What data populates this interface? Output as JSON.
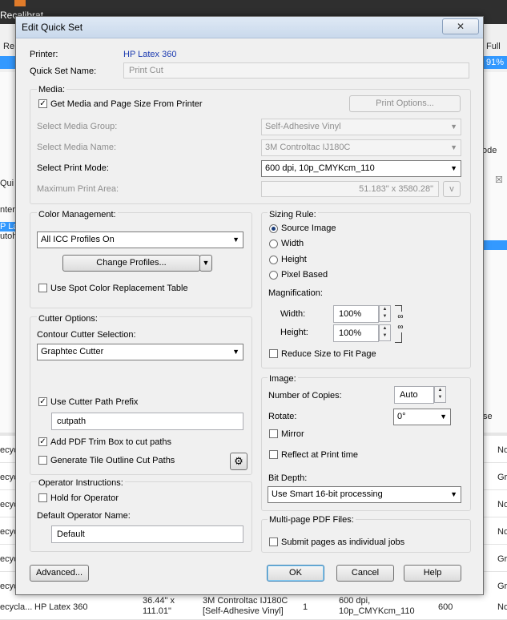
{
  "background": {
    "app_title": "Recalibrat",
    "header_re": "Re",
    "header_full": "Full",
    "percent": "91%",
    "mode_label": "ode",
    "side_qui": "Qui",
    "side_nter": "nter",
    "side_plat": "P Lat",
    "side_utoh": "utoh",
    "se_label": "se",
    "rows": [
      {
        "left": "ecyc",
        "right": "No"
      },
      {
        "left": "ecyc",
        "right": "Gr"
      },
      {
        "left": "ecyc",
        "right": "No"
      },
      {
        "left": "ecyc",
        "right": "No"
      },
      {
        "left": "ecyc",
        "right": "Gr"
      },
      {
        "left": "ecyc",
        "right": "Gr"
      }
    ],
    "bottom_row": {
      "c1": "ecycla...",
      "c2": "HP Latex 360",
      "c3a": "36.44\" x",
      "c3b": "111.01\"",
      "c4a": "3M Controltac IJ180C",
      "c4b": "[Self-Adhesive Vinyl]",
      "c5": "1",
      "c6a": "600 dpi,",
      "c6b": "10p_CMYKcm_110",
      "c7": "600",
      "c8": "No"
    }
  },
  "dialog": {
    "title": "Edit Quick Set",
    "close_label": "✕",
    "printer_label": "Printer:",
    "printer_value": "HP Latex 360",
    "quickset_label": "Quick Set Name:",
    "quickset_value": "Print Cut",
    "media": {
      "group_label": "Media:",
      "get_media_label": "Get Media and Page Size From Printer",
      "print_options_label": "Print Options...",
      "media_group_label": "Select Media Group:",
      "media_group_value": "Self-Adhesive Vinyl",
      "media_name_label": "Select Media Name:",
      "media_name_value": "3M Controltac IJ180C",
      "print_mode_label": "Select Print Mode:",
      "print_mode_value": "600 dpi, 10p_CMYKcm_110",
      "max_area_label": "Maximum Print Area:",
      "max_area_value": "51.183\" x 3580.28\"",
      "max_area_unit": "v"
    },
    "color": {
      "group_label": "Color Management:",
      "icc_value": "All ICC Profiles On",
      "change_profiles_label": "Change Profiles...",
      "spot_label": "Use Spot Color Replacement Table"
    },
    "cutter": {
      "group_label": "Cutter Options:",
      "contour_label": "Contour Cutter Selection:",
      "cutter_value": "Graphtec Cutter",
      "prefix_label": "Use Cutter Path Prefix",
      "prefix_value": "cutpath",
      "trimbox_label": "Add PDF Trim Box to cut paths",
      "tile_label": "Generate Tile Outline Cut Paths"
    },
    "operator": {
      "group_label": "Operator Instructions:",
      "hold_label": "Hold for Operator",
      "default_name_label": "Default Operator Name:",
      "default_name_value": "Default"
    },
    "sizing": {
      "group_label": "Sizing Rule:",
      "options": [
        "Source Image",
        "Width",
        "Height",
        "Pixel Based"
      ],
      "magnification_label": "Magnification:",
      "width_label": "Width:",
      "width_value": "100%",
      "height_label": "Height:",
      "height_value": "100%",
      "reduce_label": "Reduce Size to Fit Page"
    },
    "image": {
      "group_label": "Image:",
      "copies_label": "Number of Copies:",
      "copies_value": "Auto",
      "rotate_label": "Rotate:",
      "rotate_value": "0°",
      "mirror_label": "Mirror",
      "reflect_label": "Reflect at Print time",
      "bitdepth_label": "Bit Depth:",
      "bitdepth_value": "Use Smart 16-bit processing"
    },
    "multipage": {
      "group_label": "Multi-page PDF Files:",
      "submit_label": "Submit pages as individual jobs"
    },
    "buttons": {
      "advanced": "Advanced...",
      "ok": "OK",
      "cancel": "Cancel",
      "help": "Help"
    }
  }
}
